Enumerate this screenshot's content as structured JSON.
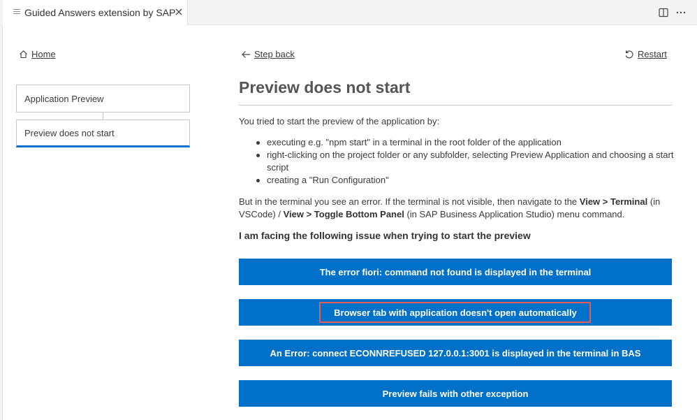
{
  "tab": {
    "title": "Guided Answers extension by SAP",
    "icons": [
      "file-icon",
      "close-icon",
      "split-editor-icon",
      "more-actions-icon"
    ]
  },
  "nav": {
    "home_label": "Home",
    "step_back_label": "Step back",
    "restart_label": "Restart"
  },
  "breadcrumbs": [
    {
      "label": "Application Preview"
    },
    {
      "label": "Preview does not start"
    }
  ],
  "page": {
    "title": "Preview does not start",
    "intro": "You tried to start the preview of the application by:",
    "bullets": [
      "executing e.g. \"npm start\" in a terminal in the root folder of the application",
      "right-clicking on the project folder or any subfolder, selecting Preview Application and choosing a start script",
      "creating a \"Run Configuration\""
    ],
    "note": {
      "part1": "But in the terminal you see an error. If the terminal is not visible, then navigate to the ",
      "bold1": "View > Terminal",
      "part2": " (in VSCode) / ",
      "bold2": "View > Toggle Bottom Panel",
      "part3": " (in SAP Business Application Studio) menu command."
    },
    "question": "I am facing the following issue when trying to start the preview"
  },
  "options": [
    {
      "label": "The error fiori: command not found is displayed in the terminal"
    },
    {
      "label": "Browser tab with application doesn't open automatically",
      "highlighted": true
    },
    {
      "label": "An Error: connect ECONNREFUSED 127.0.0.1:3001 is displayed in the terminal in BAS"
    },
    {
      "label": "Preview fails with other exception"
    }
  ],
  "colors": {
    "button_bg": "#0070c9",
    "active_underline": "#0a6ed1",
    "highlight_border": "#e25c5c"
  }
}
